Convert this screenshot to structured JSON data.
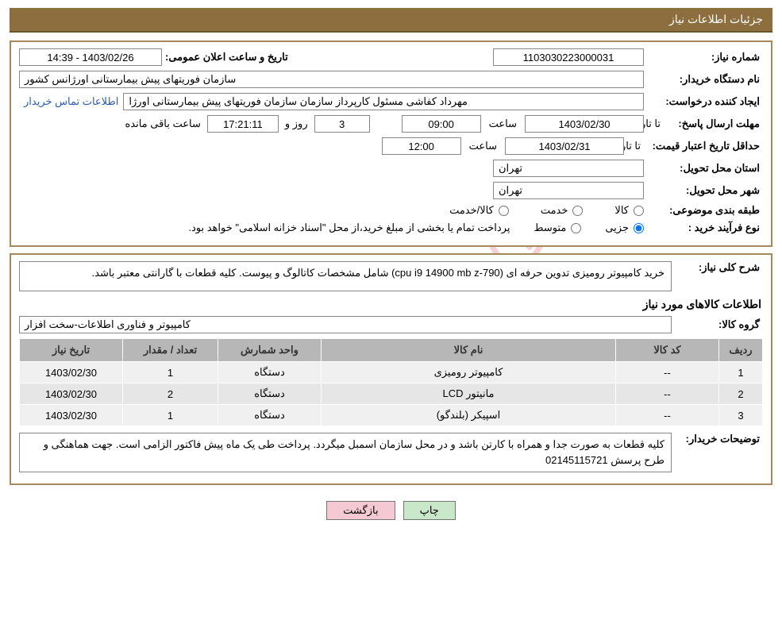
{
  "header_title": "جزئیات اطلاعات نیاز",
  "watermark_text": "AriaTender.net",
  "labels": {
    "need_no": "شماره نیاز:",
    "announce_dt": "تاریخ و ساعت اعلان عمومی:",
    "buyer_org": "نام دستگاه خریدار:",
    "requester": "ایجاد کننده درخواست:",
    "buyer_contact": "اطلاعات تماس خریدار",
    "deadline": "مهلت ارسال پاسخ:",
    "until_date": "تا تاریخ:",
    "hour": "ساعت",
    "days_and": "روز و",
    "remaining": "ساعت باقی مانده",
    "price_validity": "حداقل تاریخ اعتبار قیمت:",
    "delivery_province": "استان محل تحویل:",
    "delivery_city": "شهر محل تحویل:",
    "category": "طبقه بندی موضوعی:",
    "cat_goods": "کالا",
    "cat_service": "خدمت",
    "cat_goods_service": "کالا/خدمت",
    "process_type": "نوع فرآیند خرید :",
    "proc_minor": "جزیی",
    "proc_medium": "متوسط",
    "payment_note": "پرداخت تمام یا بخشی از مبلغ خرید،از محل \"اسناد خزانه اسلامی\" خواهد بود.",
    "need_desc": "شرح کلی نیاز:",
    "items_info": "اطلاعات کالاهای مورد نیاز",
    "goods_group": "گروه کالا:",
    "buyer_notes": "توضیحات خریدار:",
    "th_row": "ردیف",
    "th_code": "کد کالا",
    "th_name": "نام کالا",
    "th_unit": "واحد شمارش",
    "th_qty": "تعداد / مقدار",
    "th_date": "تاریخ نیاز",
    "btn_print": "چاپ",
    "btn_back": "بازگشت"
  },
  "values": {
    "need_no": "1103030223000031",
    "announce_dt": "1403/02/26 - 14:39",
    "buyer_org": "سازمان فوریتهای پیش بیمارستانی اورژانس کشور",
    "requester": "مهرداد کفاشی مسئول کارپرداز سازمان سازمان فوریتهای پیش بیمارستانی اورژا",
    "deadline_date": "1403/02/30",
    "deadline_time": "09:00",
    "remaining_days": "3",
    "remaining_clock": "17:21:11",
    "price_validity_date": "1403/02/31",
    "price_validity_time": "12:00",
    "delivery_province": "تهران",
    "delivery_city": "تهران",
    "need_desc": "خرید کامپیوتر رومیزی تدوین حرفه ای (cpu i9 14900  mb z-790) شامل مشخصات کاتالوگ و پیوست. کلیه قطعات با گارانتی معتبر باشد.",
    "goods_group": "کامپیوتر و فناوری اطلاعات-سخت افزار",
    "buyer_notes": "کلیه قطعات به صورت جدا و همراه با کارتن باشد و در محل سازمان اسمبل میگردد. پرداخت طی یک ماه پیش فاکتور الزامی است.  جهت هماهنگی و طرح پرسش 02145115721"
  },
  "radios": {
    "category_checked": false,
    "process_minor_checked": true,
    "process_medium_checked": false
  },
  "items": [
    {
      "row": "1",
      "code": "--",
      "name": "کامپیوتر رومیزی",
      "unit": "دستگاه",
      "qty": "1",
      "date": "1403/02/30"
    },
    {
      "row": "2",
      "code": "--",
      "name": "مانیتور LCD",
      "unit": "دستگاه",
      "qty": "2",
      "date": "1403/02/30"
    },
    {
      "row": "3",
      "code": "--",
      "name": "اسپیکر (بلندگو)",
      "unit": "دستگاه",
      "qty": "1",
      "date": "1403/02/30"
    }
  ]
}
